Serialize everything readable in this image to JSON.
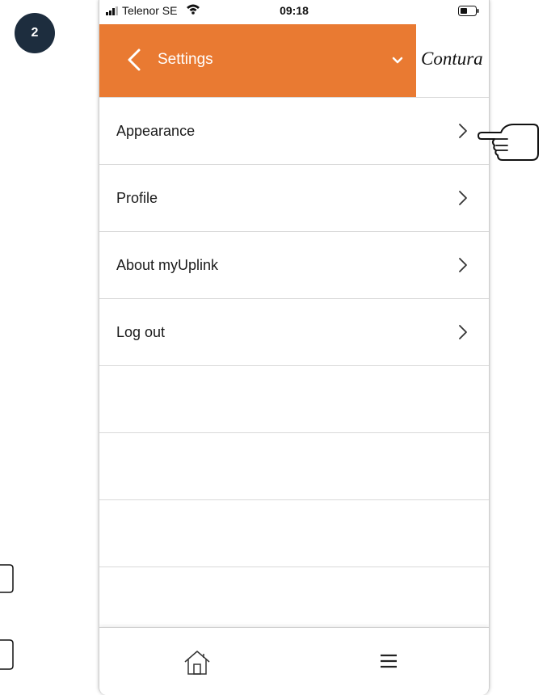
{
  "step": {
    "number": "2"
  },
  "status_bar": {
    "carrier": "Telenor SE",
    "time": "09:18"
  },
  "header": {
    "title": "Settings",
    "brand": "Contura",
    "accent_color": "#e97a32",
    "back_icon": "chevron-left-icon",
    "dropdown_icon": "chevron-down-icon"
  },
  "settings_menu": {
    "items": [
      {
        "label": "Appearance"
      },
      {
        "label": "Profile"
      },
      {
        "label": "About myUplink"
      },
      {
        "label": "Log out"
      }
    ]
  },
  "tab_bar": {
    "home_icon": "home-icon",
    "menu_icon": "hamburger-menu-icon"
  },
  "annotation": {
    "pointer_icon": "pointing-hand-icon",
    "points_at": "Appearance"
  }
}
